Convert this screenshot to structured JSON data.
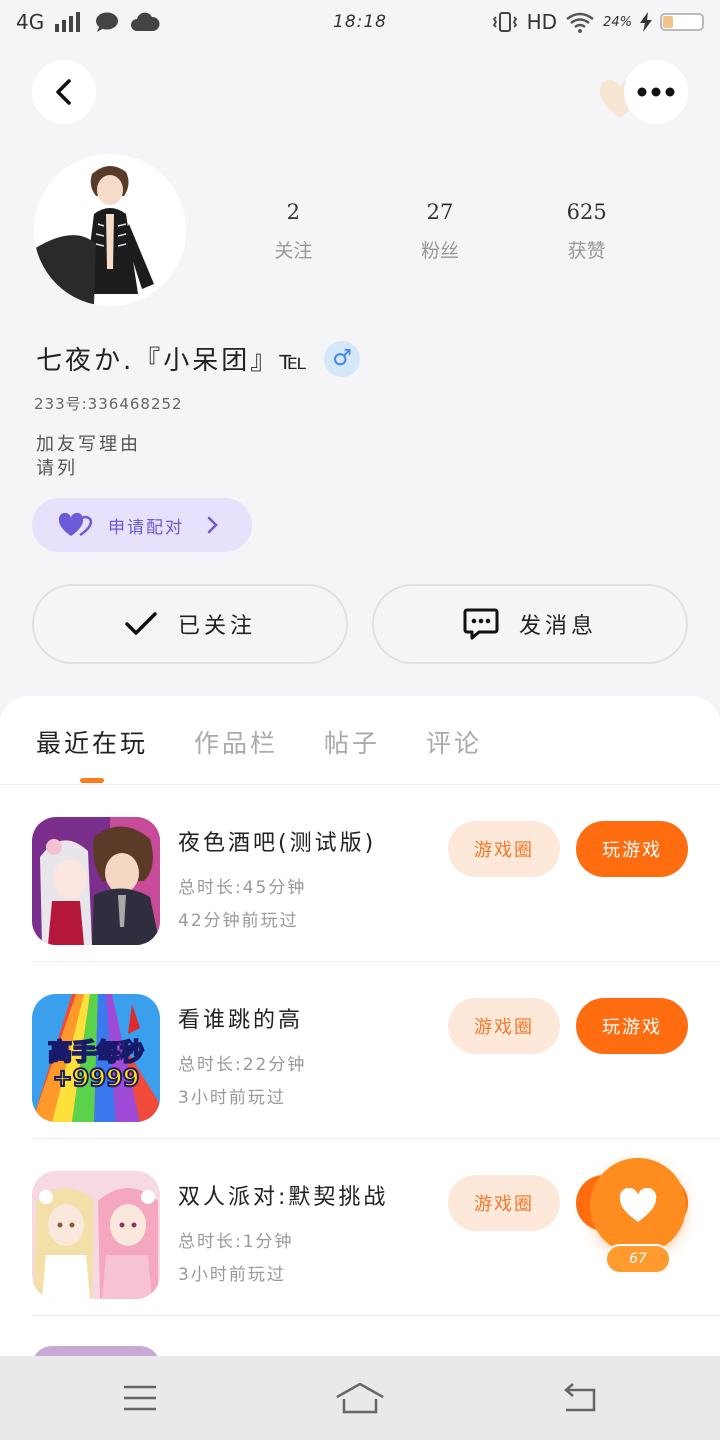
{
  "status_bar": {
    "network": "4G",
    "time": "18:18",
    "hd_label": "HD",
    "battery": "24%",
    "battery_level": 0.24
  },
  "header": {
    "back_icon": "chevron-left-icon",
    "more_icon": "more-dots-icon"
  },
  "profile": {
    "name": "七夜か.『小呆团』℡",
    "gender_symbol": "♂",
    "uid": "233号:336468252",
    "bio_line1": "加友写理由",
    "bio_line2": "请列",
    "stats": [
      {
        "value": "2",
        "label": "关注"
      },
      {
        "value": "27",
        "label": "粉丝"
      },
      {
        "value": "625",
        "label": "获赞"
      }
    ],
    "pair_button_label": "申请配对",
    "follow_button_label": "已关注",
    "message_button_label": "发消息"
  },
  "tabs": [
    {
      "label": "最近在玩",
      "active": true
    },
    {
      "label": "作品栏",
      "active": false
    },
    {
      "label": "帖子",
      "active": false
    },
    {
      "label": "评论",
      "active": false
    }
  ],
  "games": [
    {
      "title": "夜色酒吧(测试版)",
      "duration": "总时长:45分钟",
      "last_played": "42分钟前玩过",
      "circle_label": "游戏圈",
      "play_label": "玩游戏"
    },
    {
      "title": "看谁跳的高",
      "duration": "总时长:22分钟",
      "last_played": "3小时前玩过",
      "circle_label": "游戏圈",
      "play_label": "玩游戏",
      "icon_text_1": "高手每秒",
      "icon_text_2": "+9999"
    },
    {
      "title": "双人派对:默契挑战",
      "duration": "总时长:1分钟",
      "last_played": "3小时前玩过",
      "circle_label": "游戏圈",
      "play_label": "玩游戏"
    }
  ],
  "float_like": {
    "count": "67"
  },
  "colors": {
    "accent": "#ff6d10",
    "pill_bg": "#fde8da",
    "pair_bg": "#e7e1fb",
    "pair_text": "#6a5bd8"
  }
}
